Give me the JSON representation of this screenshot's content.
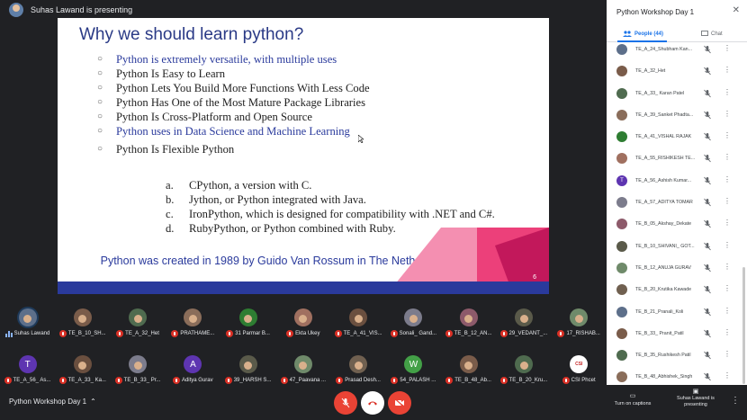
{
  "presenter_banner": "Suhas Lawand is presenting",
  "slide": {
    "title": "Why we should learn python?",
    "bullets": [
      {
        "text": "Python is extremely versatile, with multiple uses",
        "highlight": true
      },
      {
        "text": "Python Is Easy to Learn",
        "highlight": false
      },
      {
        "text": "Python Lets You Build More Functions With Less Code",
        "highlight": false
      },
      {
        "text": "Python Has One of the Most Mature Package Libraries",
        "highlight": false
      },
      {
        "text": "Python Is Cross-Platform and Open Source",
        "highlight": false
      },
      {
        "text": "Python uses in Data Science and Machine Learning",
        "highlight": true
      },
      {
        "text": "Python Is Flexible Python",
        "highlight": false
      }
    ],
    "sub_items": [
      {
        "letter": "a.",
        "text": "CPython, a version with C."
      },
      {
        "letter": "b.",
        "text": "Jython, or Python integrated with Java."
      },
      {
        "letter": "c.",
        "text": "IronPython, which is designed for compatibility with .NET and C#."
      },
      {
        "letter": "d.",
        "text": "RubyPython, or Python combined with Ruby."
      }
    ],
    "footer": "Python was created in 1989 by Guido Van Rossum in The Netherlands",
    "page_number": "6",
    "colors": {
      "title": "#2a3a86",
      "accent": "#2a3a9c",
      "deco_pink": "#f06292",
      "deco_red": "#c2185b"
    }
  },
  "strip_row1": [
    {
      "name": "Suhas Lawand",
      "muted": false,
      "speaking": true,
      "avatar": "photo"
    },
    {
      "name": "TE_B_10_SH...",
      "muted": true,
      "avatar": "photo"
    },
    {
      "name": "TE_A_32_Het",
      "muted": true,
      "avatar": "photo"
    },
    {
      "name": "PRATHAME...",
      "muted": true,
      "avatar": "photo"
    },
    {
      "name": "31 Parmar B...",
      "muted": true,
      "avatar": "photo"
    },
    {
      "name": "Ekta Ukey",
      "muted": true,
      "avatar": "photo"
    },
    {
      "name": "TE_A_41_VIS...",
      "muted": true,
      "avatar": "photo"
    },
    {
      "name": "Sonali_ Gand...",
      "muted": true,
      "avatar": "photo"
    },
    {
      "name": "TE_B_12_AN...",
      "muted": true,
      "avatar": "photo"
    },
    {
      "name": "29_VEDANT_...",
      "muted": true,
      "avatar": "photo"
    },
    {
      "name": "17_RISHAB...",
      "muted": true,
      "avatar": "photo"
    }
  ],
  "strip_row2": [
    {
      "name": "TE_A_56_ As...",
      "muted": true,
      "avatar": "T"
    },
    {
      "name": "TE_A_33_ Ka...",
      "muted": true,
      "avatar": "photo"
    },
    {
      "name": "TE_B_33_ Pr...",
      "muted": true,
      "avatar": "photo"
    },
    {
      "name": "Aditya Gurav",
      "muted": true,
      "avatar": "A"
    },
    {
      "name": "39_HARSH S...",
      "muted": true,
      "avatar": "photo"
    },
    {
      "name": "47_Paavana ...",
      "muted": true,
      "avatar": "photo"
    },
    {
      "name": "Prasad Desh...",
      "muted": true,
      "avatar": "photo"
    },
    {
      "name": "54_PALASH ...",
      "muted": true,
      "avatar": "W"
    },
    {
      "name": "TE_B_48_Ab...",
      "muted": true,
      "avatar": "photo"
    },
    {
      "name": "TE_B_20_Kru...",
      "muted": true,
      "avatar": "photo"
    },
    {
      "name": "CSI Phcet",
      "muted": true,
      "avatar": "CSI"
    }
  ],
  "panel": {
    "title": "Python Workshop Day 1",
    "tab_people": "People (44)",
    "tab_chat": "Chat",
    "participants": [
      {
        "name": "TE_A_24_Shubham Kan...",
        "avatar": "photo"
      },
      {
        "name": "TE_A_32_Het",
        "avatar": "photo"
      },
      {
        "name": "TE_A_33_ Karan Patel",
        "avatar": "photo"
      },
      {
        "name": "TE_A_39_Sanket Phadta...",
        "avatar": "photo"
      },
      {
        "name": "TE_A_41_VISHAL RAJAK",
        "avatar": "photo"
      },
      {
        "name": "TE_A_55_RISHIKESH TE...",
        "avatar": "photo"
      },
      {
        "name": "TE_A_56_Ashish Kumar...",
        "avatar": "T"
      },
      {
        "name": "TE_A_57_ADITYA TOMAR",
        "avatar": "photo"
      },
      {
        "name": "TE_B_05_Akshay_Dekate",
        "avatar": "photo"
      },
      {
        "name": "TE_B_10_SHIVANI_ GOT...",
        "avatar": "photo"
      },
      {
        "name": "TE_B_12_ANUJA GURAV",
        "avatar": "photo"
      },
      {
        "name": "TE_B_20_Krutika Kawade",
        "avatar": "photo"
      },
      {
        "name": "TE_B_21_Pranali_Koli",
        "avatar": "photo"
      },
      {
        "name": "TE_B_33_ Pranit_Patil",
        "avatar": "photo"
      },
      {
        "name": "TE_B_35_Rushikesh Patil",
        "avatar": "photo"
      },
      {
        "name": "TE_B_48_Abhishek_Singh",
        "avatar": "photo"
      }
    ]
  },
  "bottom": {
    "meeting_name": "Python Workshop Day 1",
    "captions_label": "Turn on captions",
    "presenting_label": "Suhas Lawand is presenting"
  }
}
